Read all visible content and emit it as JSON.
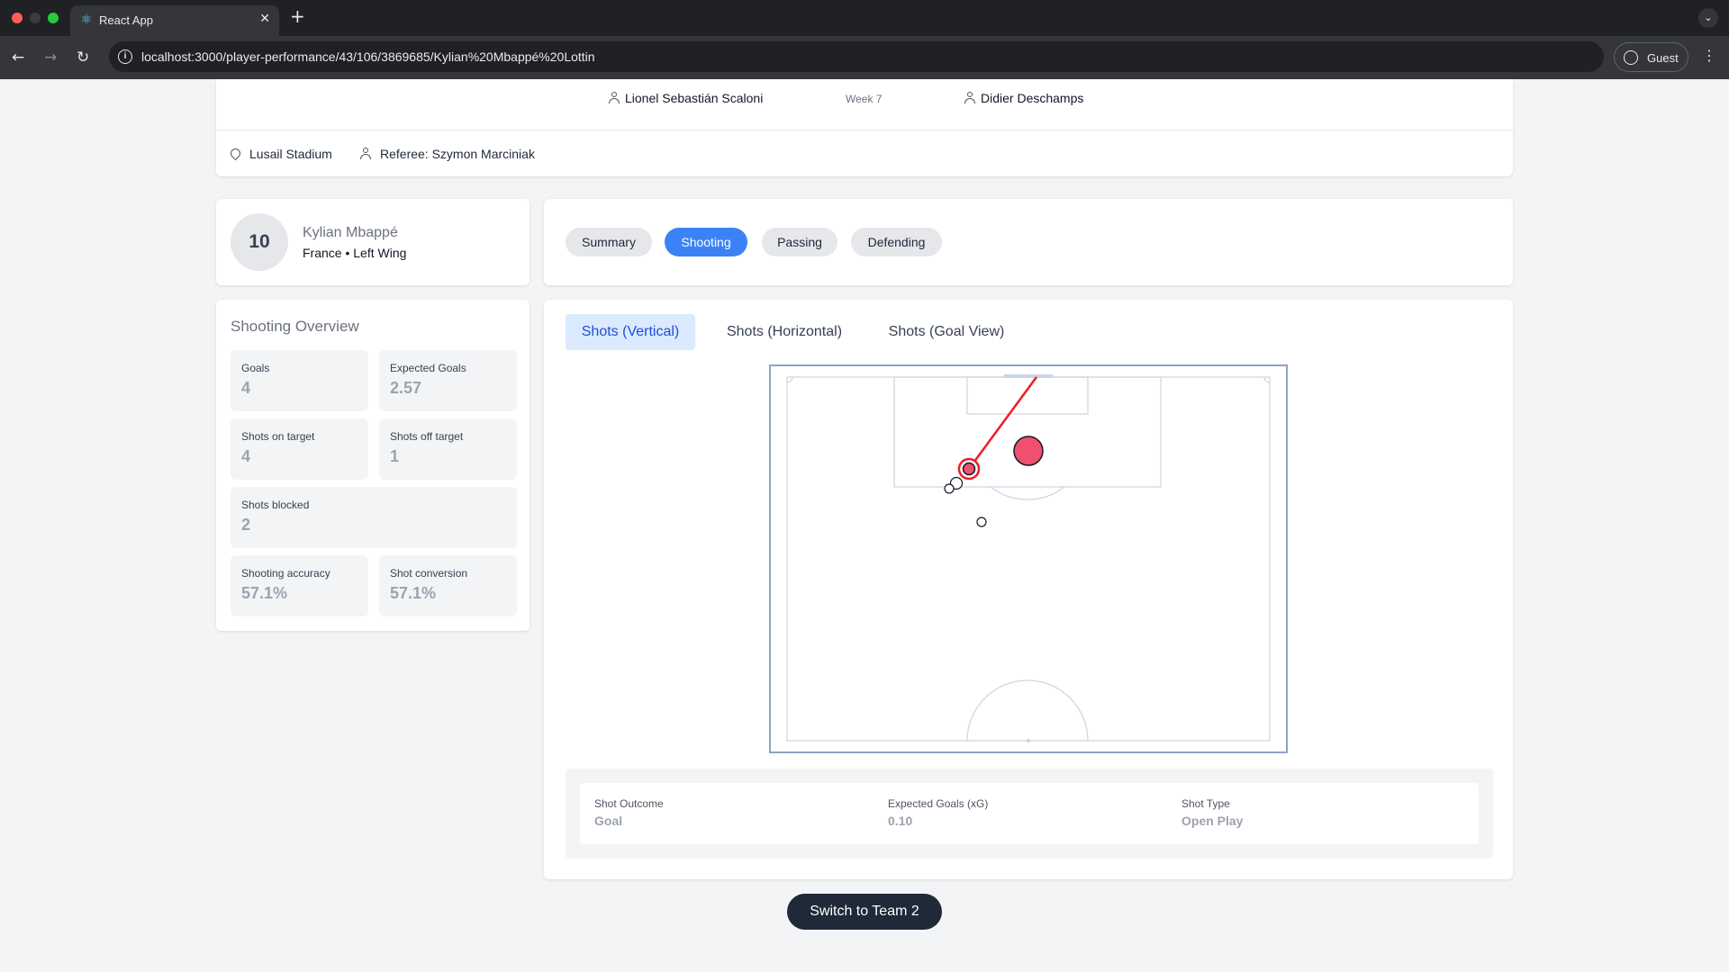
{
  "browser": {
    "tab_title": "React App",
    "url": "localhost:3000/player-performance/43/106/3869685/Kylian%20Mbappé%20Lottin",
    "guest_label": "Guest"
  },
  "match": {
    "home_coach": "Lionel Sebastián Scaloni",
    "week": "Week 7",
    "away_coach": "Didier Deschamps",
    "venue": "Lusail Stadium",
    "referee": "Referee: Szymon Marciniak"
  },
  "player": {
    "number": "10",
    "name": "Kylian Mbappé",
    "meta": "France • Left Wing"
  },
  "stat_tabs": [
    "Summary",
    "Shooting",
    "Passing",
    "Defending"
  ],
  "active_stat_tab": "Shooting",
  "overview": {
    "title": "Shooting Overview",
    "stats": [
      {
        "label": "Goals",
        "value": "4"
      },
      {
        "label": "Expected Goals",
        "value": "2.57"
      },
      {
        "label": "Shots on target",
        "value": "4"
      },
      {
        "label": "Shots off target",
        "value": "1"
      },
      {
        "label": "Shots blocked",
        "value": "2"
      },
      {
        "label": "Shooting accuracy",
        "value": "57.1%"
      },
      {
        "label": "Shot conversion",
        "value": "57.1%"
      }
    ]
  },
  "shot_views": [
    "Shots (Vertical)",
    "Shots (Horizontal)",
    "Shots (Goal View)"
  ],
  "active_shot_view": "Shots (Vertical)",
  "selected_shot": {
    "outcome_label": "Shot Outcome",
    "outcome": "Goal",
    "xg_label": "Expected Goals (xG)",
    "xg": "0.10",
    "type_label": "Shot Type",
    "type": "Open Play"
  },
  "switch_button": "Switch to Team 2",
  "colors": {
    "accent": "#3b82f6",
    "goal_marker": "#f0506e",
    "shot_line": "#ef1c24",
    "pitch_lines": "#cbd5e1",
    "pitch_frame": "#8fa3c4"
  }
}
